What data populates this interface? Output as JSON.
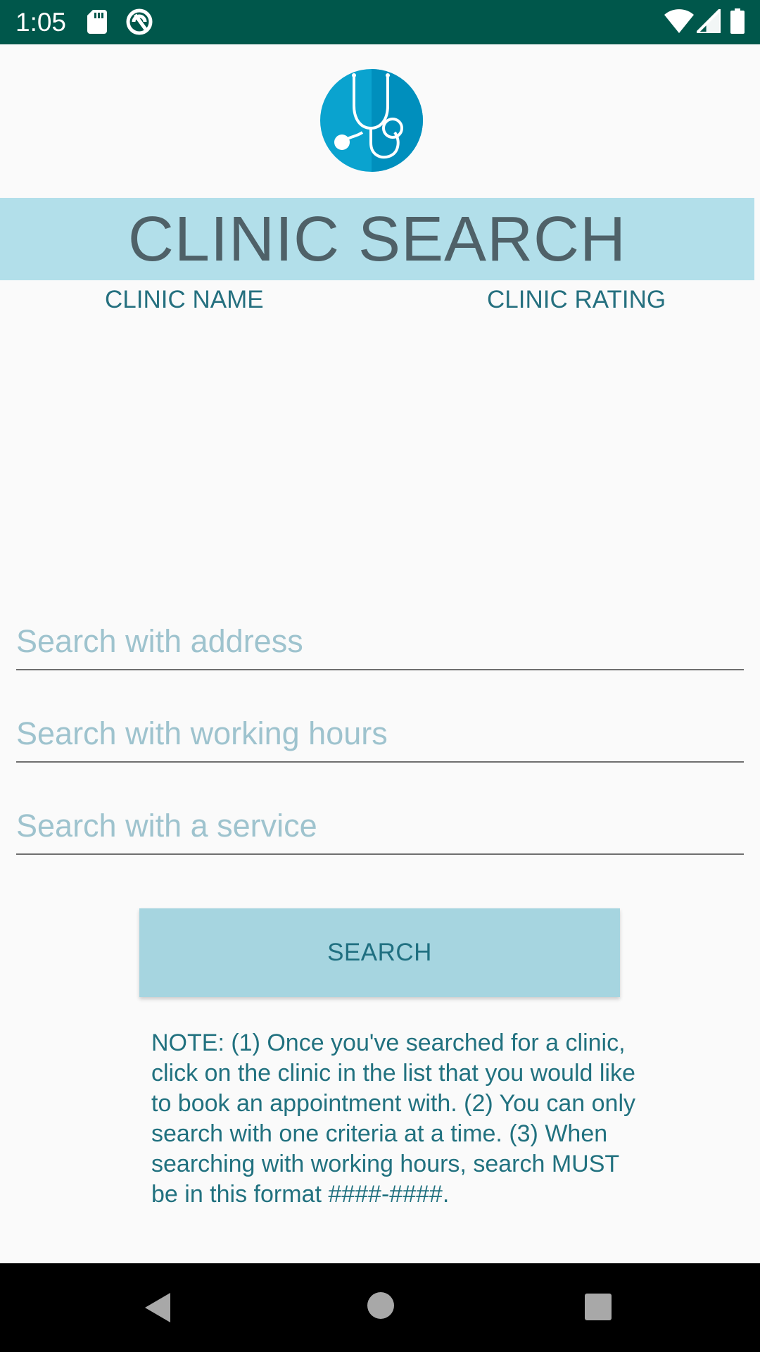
{
  "status_bar": {
    "time": "1:05",
    "icons": [
      "sd-card-icon",
      "sync-circle-icon",
      "wifi-icon",
      "signal-icon",
      "battery-icon"
    ],
    "background_color": "#00574b"
  },
  "header": {
    "logo_icon": "stethoscope-icon",
    "logo_color": "#0096c2",
    "title": "CLINIC SEARCH",
    "banner_color": "#b2dfea"
  },
  "results": {
    "columns": [
      "CLINIC NAME",
      "CLINIC RATING"
    ],
    "rows": []
  },
  "search": {
    "address_placeholder": "Search with address",
    "hours_placeholder": "Search with working hours",
    "service_placeholder": "Search with a service",
    "button_label": "SEARCH",
    "button_color": "#a6d5e0"
  },
  "note": "NOTE: (1) Once you've searched for a clinic, click on the clinic in the list that you would like to book an appointment with. (2) You can only search with one criteria at a time. (3) When searching with working hours, search MUST be in this format ####-####.",
  "nav_bar": {
    "icons": [
      "back-icon",
      "home-icon",
      "recents-icon"
    ]
  }
}
